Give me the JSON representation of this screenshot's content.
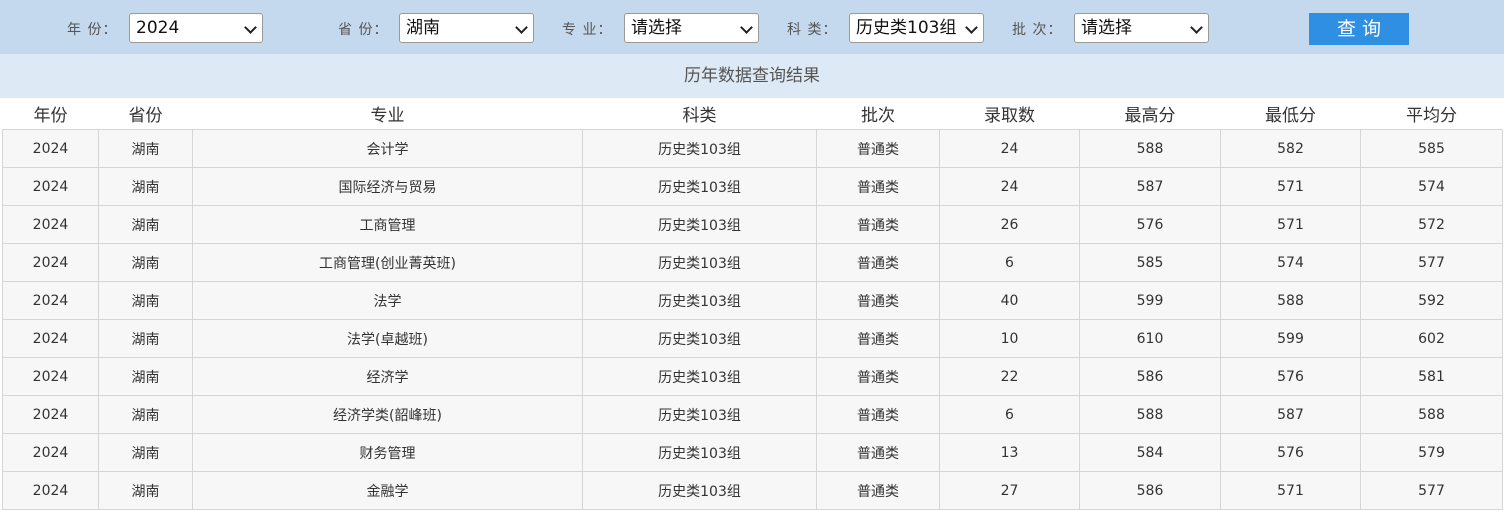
{
  "filters": {
    "year": {
      "label": "年 份：",
      "value": "2024"
    },
    "province": {
      "label": "省 份：",
      "value": "湖南"
    },
    "major": {
      "label": "专 业：",
      "value": "请选择"
    },
    "category": {
      "label": "科 类：",
      "value": "历史类103组"
    },
    "batch": {
      "label": "批 次：",
      "value": "请选择"
    },
    "query_label": "查询"
  },
  "result_title": "历年数据查询结果",
  "table": {
    "columns": [
      "年份",
      "省份",
      "专业",
      "科类",
      "批次",
      "录取数",
      "最高分",
      "最低分",
      "平均分"
    ],
    "rows": [
      [
        "2024",
        "湖南",
        "会计学",
        "历史类103组",
        "普通类",
        "24",
        "588",
        "582",
        "585"
      ],
      [
        "2024",
        "湖南",
        "国际经济与贸易",
        "历史类103组",
        "普通类",
        "24",
        "587",
        "571",
        "574"
      ],
      [
        "2024",
        "湖南",
        "工商管理",
        "历史类103组",
        "普通类",
        "26",
        "576",
        "571",
        "572"
      ],
      [
        "2024",
        "湖南",
        "工商管理(创业菁英班)",
        "历史类103组",
        "普通类",
        "6",
        "585",
        "574",
        "577"
      ],
      [
        "2024",
        "湖南",
        "法学",
        "历史类103组",
        "普通类",
        "40",
        "599",
        "588",
        "592"
      ],
      [
        "2024",
        "湖南",
        "法学(卓越班)",
        "历史类103组",
        "普通类",
        "10",
        "610",
        "599",
        "602"
      ],
      [
        "2024",
        "湖南",
        "经济学",
        "历史类103组",
        "普通类",
        "22",
        "586",
        "576",
        "581"
      ],
      [
        "2024",
        "湖南",
        "经济学类(韶峰班)",
        "历史类103组",
        "普通类",
        "6",
        "588",
        "587",
        "588"
      ],
      [
        "2024",
        "湖南",
        "财务管理",
        "历史类103组",
        "普通类",
        "13",
        "584",
        "576",
        "579"
      ],
      [
        "2024",
        "湖南",
        "金融学",
        "历史类103组",
        "普通类",
        "27",
        "586",
        "571",
        "577"
      ]
    ]
  }
}
